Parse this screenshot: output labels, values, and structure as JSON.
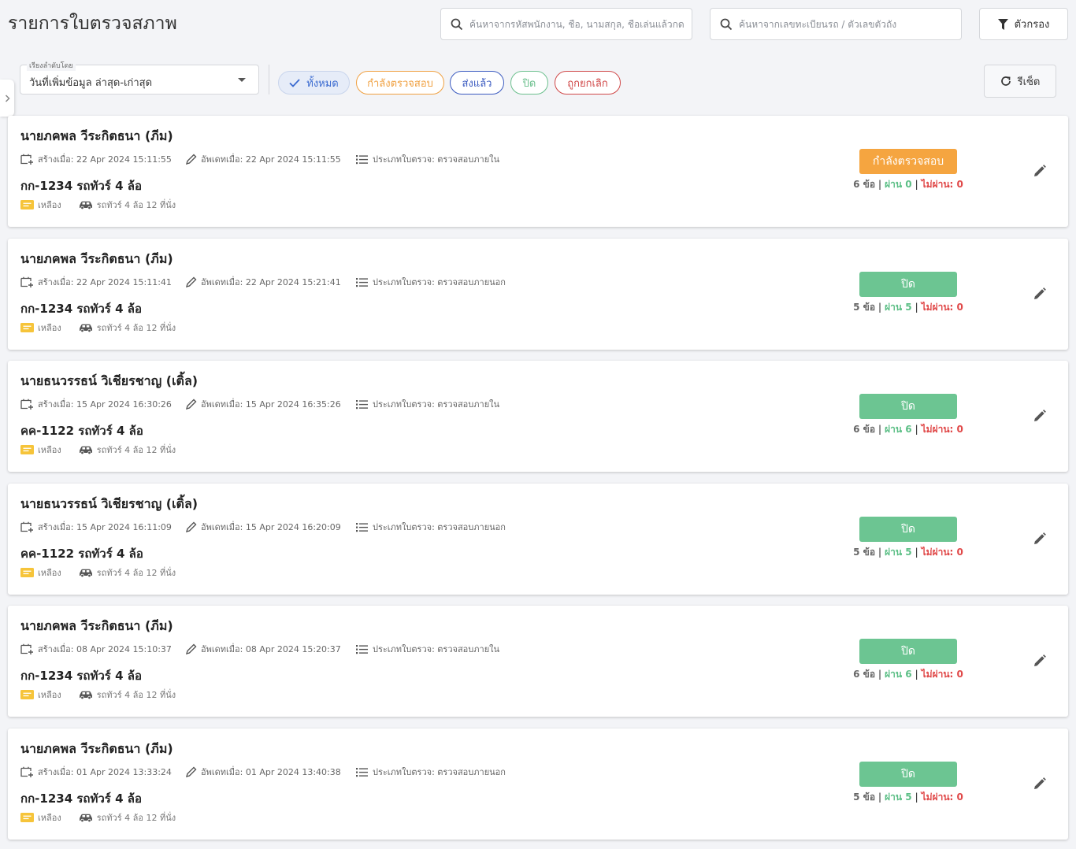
{
  "page": {
    "title": "รายการใบตรวจสภาพ"
  },
  "search": {
    "employee_placeholder": "ค้นหาจากรหัสพนักงาน, ชื่อ, นามสกุล, ชื่อเล่นแล้วกด",
    "plate_placeholder": "ค้นหาจากเลขทะเบียนรถ / ตัวเลขตัวถัง"
  },
  "filter_button": {
    "label": "ตัวกรอง",
    "icon": "funnel-icon"
  },
  "sort": {
    "legend": "เรียงลำดับโดย",
    "value": "วันที่เพิ่มข้อมูล ล่าสุด-เก่าสุด"
  },
  "status_filters": [
    {
      "label": "ทั้งหมด",
      "selected": true
    },
    {
      "label": "กำลังตรวจสอบ"
    },
    {
      "label": "ส่งแล้ว"
    },
    {
      "label": "ปิด"
    },
    {
      "label": "ถูกยกเลิก"
    }
  ],
  "reset_button": {
    "label": "รีเซ็ต",
    "icon": "refresh-icon"
  },
  "colors": {
    "in_progress": "#f5a540",
    "closed": "#6cc592",
    "pass": "#5cbf86",
    "fail": "#e04848",
    "yellow_tag": "#f6c43a"
  },
  "records": [
    {
      "name": "นายภคพล วีระกิตธนา (ภีม)",
      "created": "สร้างเมื่อ: 22 Apr 2024 15:11:55",
      "updated": "อัพเดทเมื่อ: 22 Apr 2024 15:11:55",
      "type": "ประเภทใบตรวจ: ตรวจสอบภายใน",
      "plate": "กก-1234 รถทัวร์ 4 ล้อ",
      "color": "เหลือง",
      "vehicle": "รถทัวร์ 4 ล้อ 12 ที่นั่ง",
      "status": "กำลังตรวจสอบ",
      "status_kind": "in_progress",
      "items": "6 ข้อ",
      "pass": "ผ่าน 0",
      "fail": "ไม่ผ่าน: 0"
    },
    {
      "name": "นายภคพล วีระกิตธนา (ภีม)",
      "created": "สร้างเมื่อ: 22 Apr 2024 15:11:41",
      "updated": "อัพเดทเมื่อ: 22 Apr 2024 15:21:41",
      "type": "ประเภทใบตรวจ: ตรวจสอบภายนอก",
      "plate": "กก-1234 รถทัวร์ 4 ล้อ",
      "color": "เหลือง",
      "vehicle": "รถทัวร์ 4 ล้อ 12 ที่นั่ง",
      "status": "ปิด",
      "status_kind": "closed",
      "items": "5 ข้อ",
      "pass": "ผ่าน 5",
      "fail": "ไม่ผ่าน: 0"
    },
    {
      "name": "นายธนวรรธน์ วิเชียรชาญ (เติ้ล)",
      "created": "สร้างเมื่อ: 15 Apr 2024 16:30:26",
      "updated": "อัพเดทเมื่อ: 15 Apr 2024 16:35:26",
      "type": "ประเภทใบตรวจ: ตรวจสอบภายใน",
      "plate": "คค-1122 รถทัวร์ 4 ล้อ",
      "color": "เหลือง",
      "vehicle": "รถทัวร์ 4 ล้อ 12 ที่นั่ง",
      "status": "ปิด",
      "status_kind": "closed",
      "items": "6 ข้อ",
      "pass": "ผ่าน 6",
      "fail": "ไม่ผ่าน: 0"
    },
    {
      "name": "นายธนวรรธน์ วิเชียรชาญ (เติ้ล)",
      "created": "สร้างเมื่อ: 15 Apr 2024 16:11:09",
      "updated": "อัพเดทเมื่อ: 15 Apr 2024 16:20:09",
      "type": "ประเภทใบตรวจ: ตรวจสอบภายนอก",
      "plate": "คค-1122 รถทัวร์ 4 ล้อ",
      "color": "เหลือง",
      "vehicle": "รถทัวร์ 4 ล้อ 12 ที่นั่ง",
      "status": "ปิด",
      "status_kind": "closed",
      "items": "5 ข้อ",
      "pass": "ผ่าน 5",
      "fail": "ไม่ผ่าน: 0"
    },
    {
      "name": "นายภคพล วีระกิตธนา (ภีม)",
      "created": "สร้างเมื่อ: 08 Apr 2024 15:10:37",
      "updated": "อัพเดทเมื่อ: 08 Apr 2024 15:20:37",
      "type": "ประเภทใบตรวจ: ตรวจสอบภายใน",
      "plate": "กก-1234 รถทัวร์ 4 ล้อ",
      "color": "เหลือง",
      "vehicle": "รถทัวร์ 4 ล้อ 12 ที่นั่ง",
      "status": "ปิด",
      "status_kind": "closed",
      "items": "6 ข้อ",
      "pass": "ผ่าน 6",
      "fail": "ไม่ผ่าน: 0"
    },
    {
      "name": "นายภคพล วีระกิตธนา (ภีม)",
      "created": "สร้างเมื่อ: 01 Apr 2024 13:33:24",
      "updated": "อัพเดทเมื่อ: 01 Apr 2024 13:40:38",
      "type": "ประเภทใบตรวจ: ตรวจสอบภายนอก",
      "plate": "กก-1234 รถทัวร์ 4 ล้อ",
      "color": "เหลือง",
      "vehicle": "รถทัวร์ 4 ล้อ 12 ที่นั่ง",
      "status": "ปิด",
      "status_kind": "closed",
      "items": "5 ข้อ",
      "pass": "ผ่าน 5",
      "fail": "ไม่ผ่าน: 0"
    }
  ]
}
